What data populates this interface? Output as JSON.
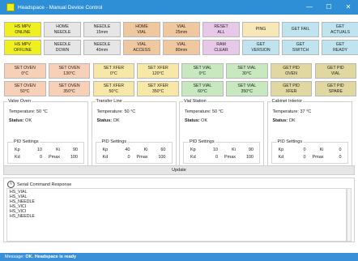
{
  "window": {
    "title": "Headspace - Manual Device Control",
    "minimize": "—",
    "maximize": "☐",
    "close": "✕"
  },
  "buttons": [
    {
      "l1": "HS MPV",
      "l2": "ONLINE",
      "bg": "#f0f020"
    },
    {
      "l1": "HOME",
      "l2": "NEEDLE",
      "bg": "#e6e6e6"
    },
    {
      "l1": "NEEDLE",
      "l2": "15mm",
      "bg": "#e6e6e6"
    },
    {
      "l1": "HOME",
      "l2": "VIAL",
      "bg": "#f0c8a0"
    },
    {
      "l1": "VIAL",
      "l2": "25mm",
      "bg": "#f0c8a0"
    },
    {
      "l1": "RESET",
      "l2": "ALL",
      "bg": "#e8c8e8"
    },
    {
      "l1": "PING",
      "l2": "",
      "bg": "#f8e8b8"
    },
    {
      "l1": "GET FAIL",
      "l2": "",
      "bg": "#bfe4f0"
    },
    {
      "l1": "GET",
      "l2": "ACTUALS",
      "bg": "#bfe4f0"
    },
    {
      "l1": "HS MPV",
      "l2": "OFFLINE",
      "bg": "#f0f020"
    },
    {
      "l1": "NEEDLE",
      "l2": "DOWN",
      "bg": "#e6e6e6"
    },
    {
      "l1": "NEEDLE",
      "l2": "40mm",
      "bg": "#e6e6e6"
    },
    {
      "l1": "VIAL",
      "l2": "ACCESS",
      "bg": "#f0c8a0"
    },
    {
      "l1": "VIAL",
      "l2": "80mm",
      "bg": "#f0c8a0"
    },
    {
      "l1": "RAM",
      "l2": "CLEAR",
      "bg": "#e8c8e8"
    },
    {
      "l1": "GET",
      "l2": "VERSION",
      "bg": "#bfe4f0"
    },
    {
      "l1": "GET",
      "l2": "SWITCH",
      "bg": "#bfe4f0"
    },
    {
      "l1": "GET",
      "l2": "READY",
      "bg": "#bfe4f0"
    },
    {
      "l1": "SET OVEN",
      "l2": "0°C",
      "bg": "#f8d0b8"
    },
    {
      "l1": "SET OVEN",
      "l2": "130°C",
      "bg": "#f8d0b8"
    },
    {
      "l1": "SET XFER",
      "l2": "0°C",
      "bg": "#f8e8a8"
    },
    {
      "l1": "SET XFER",
      "l2": "120°C",
      "bg": "#f8e8a8"
    },
    {
      "l1": "SET VIAL",
      "l2": "0°C",
      "bg": "#c8e8c0"
    },
    {
      "l1": "SET VIAL",
      "l2": "30°C",
      "bg": "#c8e8c0"
    },
    {
      "l1": "GET PID",
      "l2": "OVEN",
      "bg": "#e0d8a0"
    },
    {
      "l1": "GET PID",
      "l2": "VIAL",
      "bg": "#e0d8a0"
    },
    {
      "l1": "SET OVEN",
      "l2": "50°C",
      "bg": "#f8d0b8"
    },
    {
      "l1": "SET OVEN",
      "l2": "350°C",
      "bg": "#f8d0b8"
    },
    {
      "l1": "SET XFER",
      "l2": "50°C",
      "bg": "#f8e8a8"
    },
    {
      "l1": "SET XFER",
      "l2": "350°C",
      "bg": "#f8e8a8"
    },
    {
      "l1": "SET VIAL",
      "l2": "60°C",
      "bg": "#c8e8c0"
    },
    {
      "l1": "SET VIAL",
      "l2": "350°C",
      "bg": "#c8e8c0"
    },
    {
      "l1": "GET PID",
      "l2": "XFER",
      "bg": "#e0d8a0"
    },
    {
      "l1": "GET PID",
      "l2": "SPARE",
      "bg": "#e0d8a0"
    }
  ],
  "panels": [
    {
      "title": "Valve Oven",
      "temp_label": "Temperature:",
      "temp": "50",
      "unit": "°C",
      "status_label": "Status:",
      "status": "OK",
      "pid_title": "PID Settings",
      "kp_l": "Kp",
      "kp": "10",
      "ki_l": "Ki",
      "ki": "90",
      "kd_l": "Kd",
      "kd": "0",
      "pmax_l": "Pmax",
      "pmax": "100"
    },
    {
      "title": "Transfer Line",
      "temp_label": "Temperature:",
      "temp": "50",
      "unit": "°C",
      "status_label": "Status:",
      "status": "OK",
      "pid_title": "PID Settings",
      "kp_l": "Kp",
      "kp": "40",
      "ki_l": "Ki",
      "ki": "60",
      "kd_l": "Kd",
      "kd": "0",
      "pmax_l": "Pmax",
      "pmax": "100"
    },
    {
      "title": "Vial Station",
      "temp_label": "Temperature:",
      "temp": "50",
      "unit": "°C",
      "status_label": "Status:",
      "status": "OK",
      "pid_title": "PID Settings",
      "kp_l": "Kp",
      "kp": "10",
      "ki_l": "Ki",
      "ki": "90",
      "kd_l": "Kd",
      "kd": "0",
      "pmax_l": "Pmax",
      "pmax": "100"
    },
    {
      "title": "Cabinet Interior",
      "temp_label": "Temperature:",
      "temp": "37",
      "unit": "°C",
      "status_label": "Status:",
      "status": "OK",
      "pid_title": "PID Settings",
      "kp_l": "Kp",
      "kp": "0",
      "ki_l": "Ki",
      "ki": "0",
      "kd_l": "Kd",
      "kd": "0",
      "pmax_l": "Pmax",
      "pmax": "0"
    }
  ],
  "update_label": "Update",
  "serial": {
    "title": "Serial Command Response",
    "lines": [
      "HS_VIAL",
      "HS_VIAL",
      "HS_NEEDLE",
      "HS_VICI",
      "HS_VICI",
      "HS_NEEDLE"
    ]
  },
  "status": {
    "prefix": "Message:",
    "text": "OK. Headspace is ready"
  }
}
